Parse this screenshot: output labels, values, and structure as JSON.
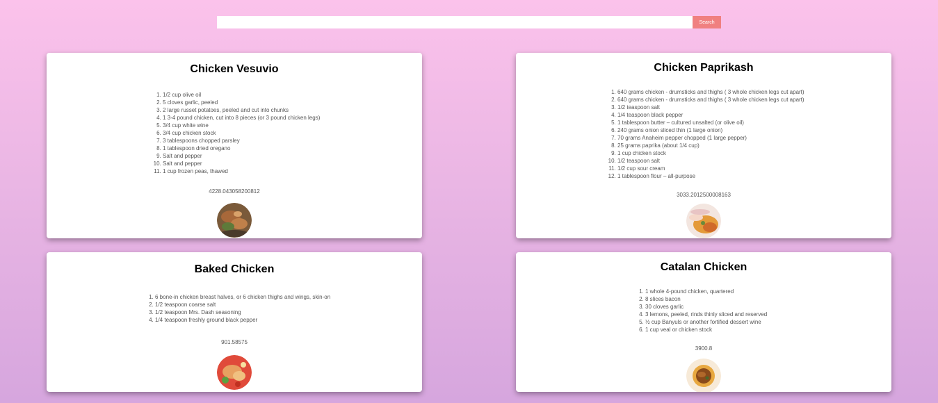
{
  "search": {
    "placeholder": "",
    "value": "",
    "button_label": "Search"
  },
  "recipes": [
    {
      "title": "Chicken Vesuvio",
      "ingredients": [
        "1/2 cup olive oil",
        "5 cloves garlic, peeled",
        "2 large russet potatoes, peeled and cut into chunks",
        "1 3-4 pound chicken, cut into 8 pieces (or 3 pound chicken legs)",
        "3/4 cup white wine",
        "3/4 cup chicken stock",
        "3 tablespoons chopped parsley",
        "1 tablespoon dried oregano",
        "Salt and pepper",
        "Salt and pepper",
        "1 cup frozen peas, thawed"
      ],
      "score": "4228.043058200812",
      "image": "chicken-dish-photo"
    },
    {
      "title": "Chicken Paprikash",
      "ingredients": [
        "640 grams chicken - drumsticks and thighs ( 3 whole chicken legs cut apart)",
        "640 grams chicken - drumsticks and thighs ( 3 whole chicken legs cut apart)",
        "1/2 teaspoon salt",
        "1/4 teaspoon black pepper",
        "1 tablespoon butter – cultured unsalted (or olive oil)",
        "240 grams onion sliced thin (1 large onion)",
        "70 grams Anaheim pepper chopped (1 large pepper)",
        "25 grams paprika (about 1/4 cup)",
        "1 cup chicken stock",
        "1/2 teaspoon salt",
        "1/2 cup sour cream",
        "1 tablespoon flour – all-purpose"
      ],
      "score": "3033.2012500008163",
      "image": "paprikash-dish-photo"
    },
    {
      "title": "Baked Chicken",
      "ingredients": [
        "6 bone-in chicken breast halves, or 6 chicken thighs and wings, skin-on",
        "1/2 teaspoon coarse salt",
        "1/2 teaspoon Mrs. Dash seasoning",
        "1/4 teaspoon freshly ground black pepper"
      ],
      "score": "901.58575",
      "image": "baked-chicken-photo"
    },
    {
      "title": "Catalan Chicken",
      "ingredients": [
        "1 whole 4-pound chicken, quartered",
        "8 slices bacon",
        "30 cloves garlic",
        "3 lemons, peeled, rinds thinly sliced and reserved",
        "½ cup Banyuls or another fortified dessert wine",
        "1 cup veal or chicken stock"
      ],
      "score": "3900.8",
      "image": "catalan-chicken-photo"
    }
  ],
  "colors": {
    "background_top": "#fbc2eb",
    "background_bottom": "#d6a6de",
    "search_button": "#f08080",
    "card": "#ffffff"
  }
}
